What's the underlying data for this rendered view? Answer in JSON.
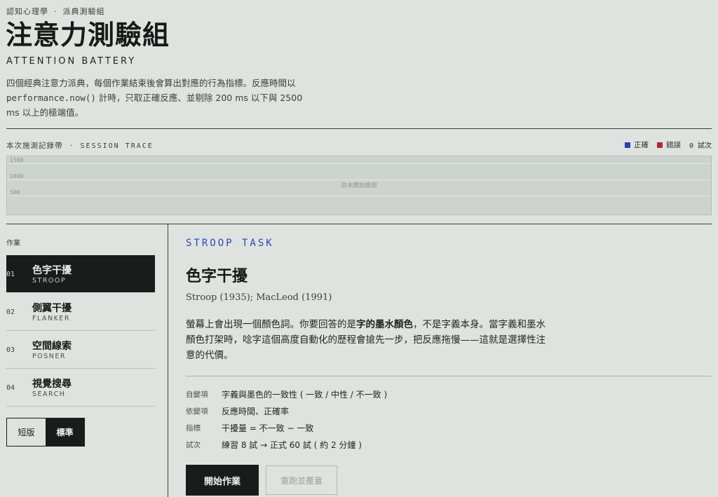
{
  "breadcrumb": {
    "parent": "認知心理學",
    "separator": "·",
    "current": "派典測驗組"
  },
  "page": {
    "title": "注意力測驗組",
    "subtitle": "ATTENTION BATTERY",
    "intro_1": "四個經典注意力派典，每個作業結束後會算出對應的行為指標。反應時間以 ",
    "intro_code": "performance.now()",
    "intro_2": " 計時，只取正確反應、並剔除 200 ms 以下與 2500 ms 以上的極端值。"
  },
  "trace": {
    "label_zh": "本次施測記錄帶",
    "label_sep": "·",
    "label_en": "SESSION TRACE",
    "legend": {
      "correct": "正確",
      "error": "錯誤",
      "count": "0 試次",
      "correct_color": "#2a3fb5",
      "error_color": "#b5243c"
    },
    "y_ticks": [
      "1500",
      "1000",
      "500"
    ],
    "empty_text": "尚未開始施測"
  },
  "sidebar": {
    "heading": "作業",
    "tasks": [
      {
        "num": "01",
        "name": "色字干擾",
        "code": "STROOP",
        "active": true
      },
      {
        "num": "02",
        "name": "側翼干擾",
        "code": "FLANKER",
        "active": false
      },
      {
        "num": "03",
        "name": "空間線索",
        "code": "POSNER",
        "active": false
      },
      {
        "num": "04",
        "name": "視覺搜尋",
        "code": "SEARCH",
        "active": false
      }
    ],
    "mode": {
      "short": "短版",
      "standard": "標準",
      "selected": "標準"
    }
  },
  "task": {
    "kicker": "STROOP TASK",
    "title": "色字干擾",
    "citation": "Stroop (1935); MacLeod (1991)",
    "desc_1": "螢幕上會出現一個顏色詞。你要回答的是",
    "desc_bold": "字的墨水顏色",
    "desc_2": "，不是字義本身。當字義和墨水顏色打架時，唸字這個高度自動化的歷程會搶先一步，把反應拖慢——這就是選擇性注意的代價。",
    "meta": [
      {
        "key": "自變項",
        "value": "字義與墨色的一致性 ( 一致 / 中性 / 不一致 )"
      },
      {
        "key": "依變項",
        "value": "反應時間、正確率"
      },
      {
        "key": "指標",
        "value": "干擾量 = 不一致 − 一致"
      },
      {
        "key": "試次",
        "value": "練習 8 試 → 正式 60 試 ( 約 2 分鐘 )"
      }
    ],
    "start_label": "開始作業",
    "rerun_label": "重跑並覆蓋"
  }
}
